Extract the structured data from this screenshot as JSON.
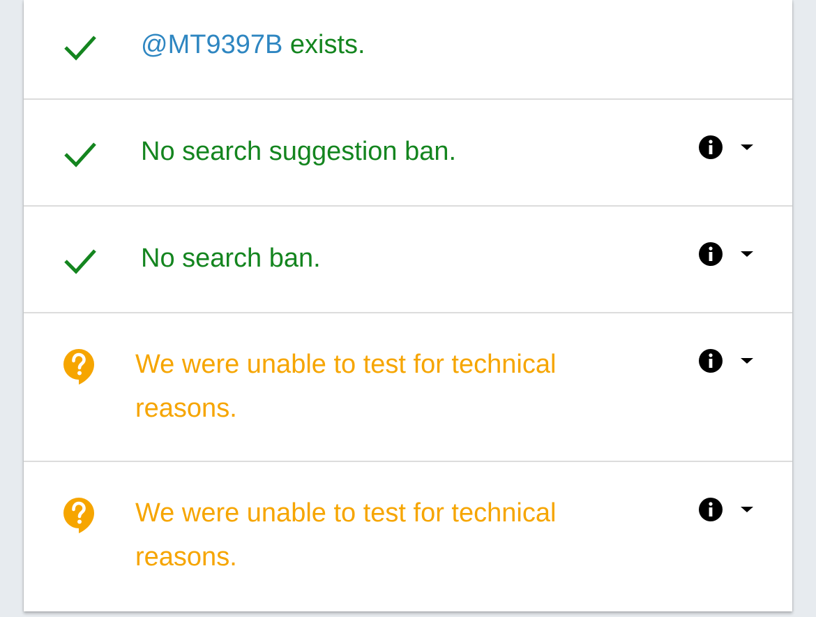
{
  "results": [
    {
      "status": "ok",
      "status_icon": "check-icon",
      "handle": "@MT9397B",
      "text": " exists.",
      "has_details": false
    },
    {
      "status": "ok",
      "status_icon": "check-icon",
      "text": "No search suggestion ban.",
      "has_details": true
    },
    {
      "status": "ok",
      "status_icon": "check-icon",
      "text": "No search ban.",
      "has_details": true
    },
    {
      "status": "unknown",
      "status_icon": "question-bubble-icon",
      "text_line1": "We were unable to test for technical",
      "text_line2": "reasons.",
      "has_details": true
    },
    {
      "status": "unknown",
      "status_icon": "question-bubble-icon",
      "text_line1": "We were unable to test for technical",
      "text_line2": "reasons.",
      "has_details": true
    }
  ],
  "colors": {
    "ok": "#14851f",
    "unknown": "#f6a500",
    "handle": "#2e86c1"
  }
}
